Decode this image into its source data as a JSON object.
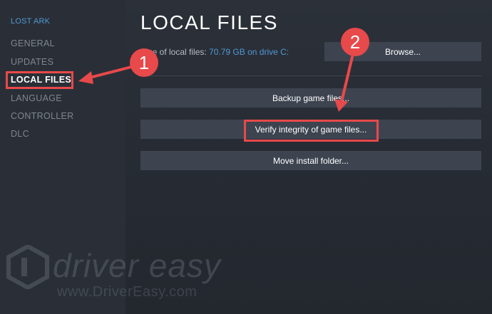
{
  "sidebar": {
    "game_title": "LOST ARK",
    "items": [
      {
        "label": "GENERAL"
      },
      {
        "label": "UPDATES"
      },
      {
        "label": "LOCAL FILES"
      },
      {
        "label": "LANGUAGE"
      },
      {
        "label": "CONTROLLER"
      },
      {
        "label": "DLC"
      }
    ],
    "active_item": "LOCAL FILES"
  },
  "main": {
    "title": "LOCAL FILES",
    "size_label": "Size of local files:",
    "size_value": "70.79 GB on drive C:",
    "browse_label": "Browse...",
    "backup_label": "Backup game files...",
    "verify_label": "Verify integrity of game files...",
    "move_label": "Move install folder..."
  },
  "annotations": {
    "step1": "1",
    "step2": "2",
    "color": "#e8494a"
  },
  "watermark": {
    "name": "driver easy",
    "url": "www.DriverEasy.com"
  },
  "colors": {
    "accent": "#4f99d3",
    "button": "#3d4450",
    "background": "#262b33"
  }
}
